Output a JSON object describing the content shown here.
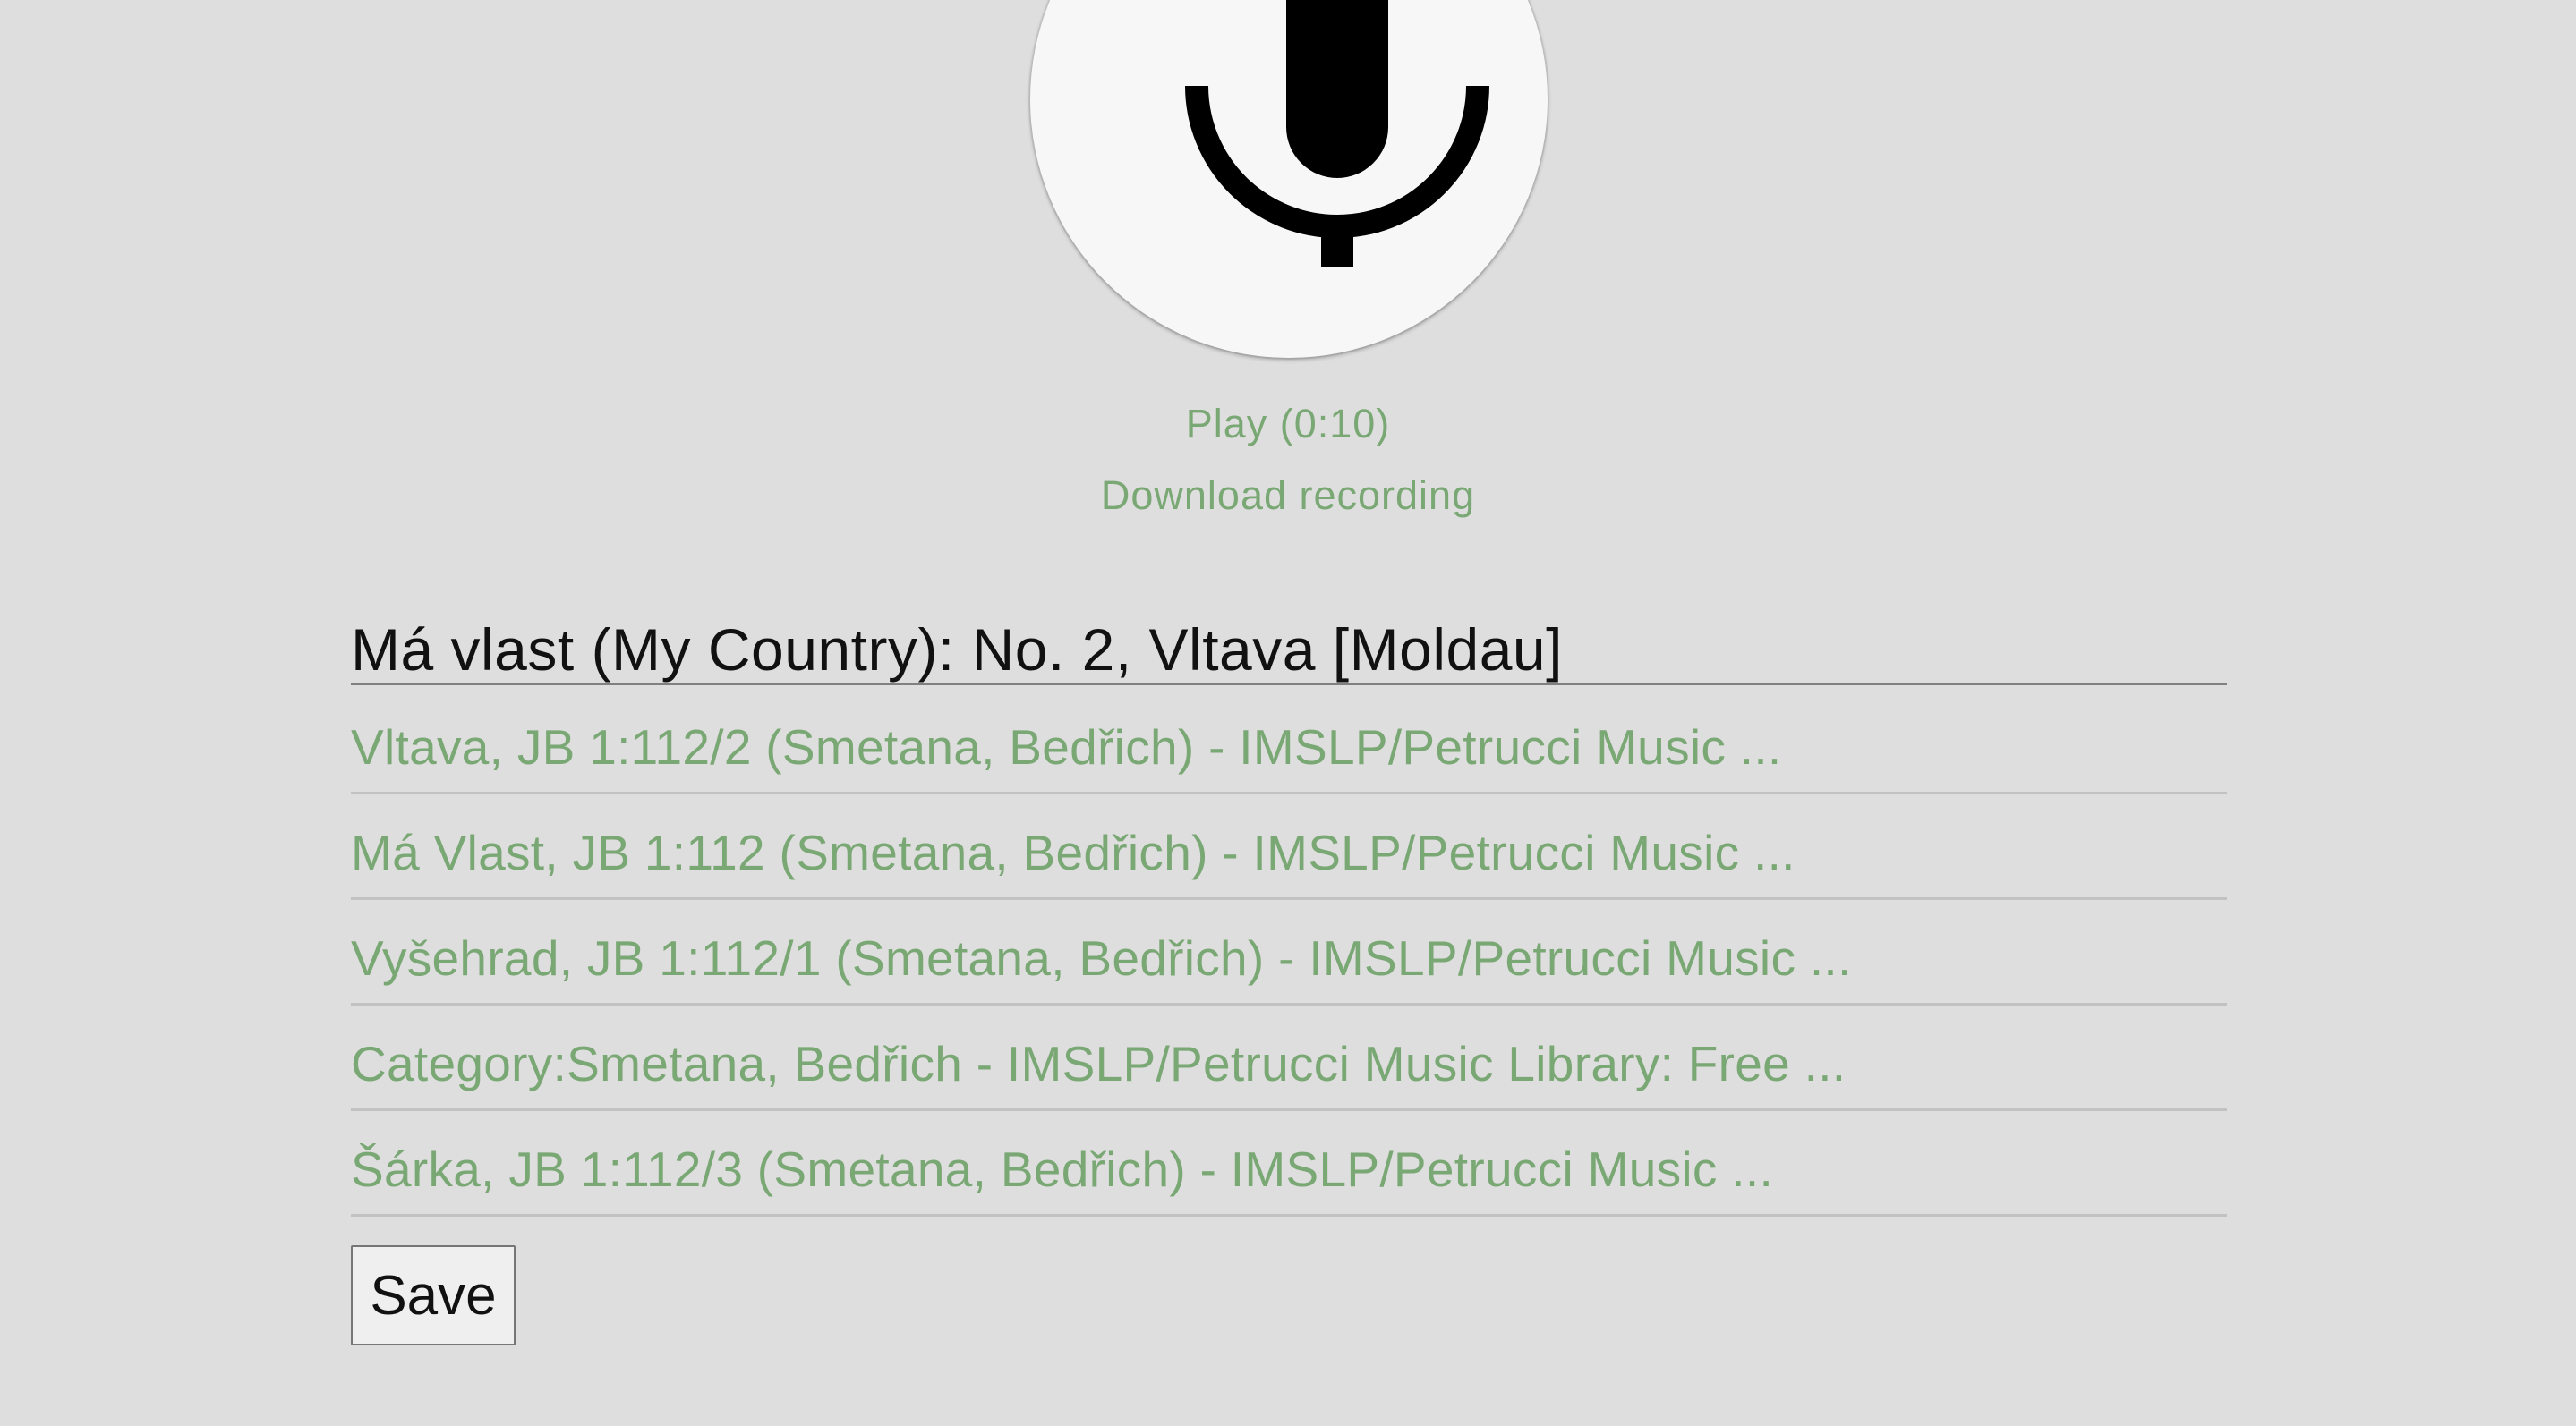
{
  "recorder": {
    "mic_icon": "microphone-icon",
    "play_label": "Play (0:10)",
    "download_label": "Download recording"
  },
  "song": {
    "title": "Má vlast (My Country): No. 2, Vltava [Moldau]"
  },
  "results": [
    "Vltava, JB 1:112/2 (Smetana, Bedřich) - IMSLP/Petrucci Music ...",
    "Má Vlast, JB 1:112 (Smetana, Bedřich) - IMSLP/Petrucci Music ...",
    "Vyšehrad, JB 1:112/1 (Smetana, Bedřich) - IMSLP/Petrucci Music ...",
    "Category:Smetana, Bedřich - IMSLP/Petrucci Music Library: Free ...",
    "Šárka, JB 1:112/3 (Smetana, Bedřich) - IMSLP/Petrucci Music ..."
  ],
  "save_label": "Save",
  "colors": {
    "background": "#dedede",
    "link": "#7aa874",
    "text": "#111111"
  }
}
